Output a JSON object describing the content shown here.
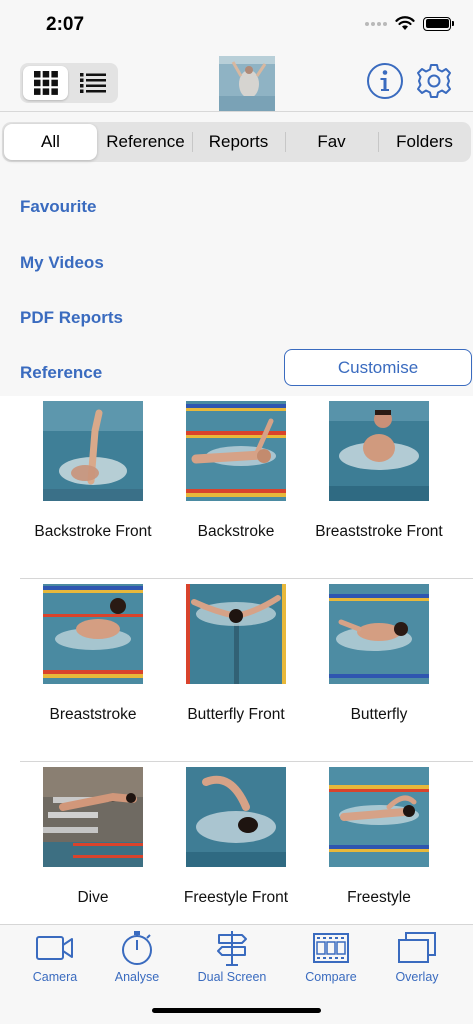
{
  "status_bar": {
    "time": "2:07"
  },
  "toolbar": {
    "view_modes": [
      "grid",
      "list"
    ],
    "selected_view": "grid",
    "info_icon": "info-icon",
    "settings_icon": "gear-icon"
  },
  "tabs": [
    {
      "label": "All",
      "active": true
    },
    {
      "label": "Reference",
      "active": false
    },
    {
      "label": "Reports",
      "active": false
    },
    {
      "label": "Fav",
      "active": false
    },
    {
      "label": "Folders",
      "active": false
    }
  ],
  "quick_links": [
    {
      "label": "Favourite"
    },
    {
      "label": "My Videos"
    },
    {
      "label": "PDF Reports"
    },
    {
      "label": "Reference"
    }
  ],
  "customise_label": "Customise",
  "videos": [
    {
      "label": "Backstroke Front"
    },
    {
      "label": "Backstroke"
    },
    {
      "label": "Breaststroke Front"
    },
    {
      "label": "Breaststroke"
    },
    {
      "label": "Butterfly Front"
    },
    {
      "label": "Butterfly"
    },
    {
      "label": "Dive"
    },
    {
      "label": "Freestyle Front"
    },
    {
      "label": "Freestyle"
    }
  ],
  "bottom_tabs": [
    {
      "label": "Camera",
      "icon": "camera-icon"
    },
    {
      "label": "Analyse",
      "icon": "stopwatch-icon"
    },
    {
      "label": "Dual Screen",
      "icon": "signpost-icon"
    },
    {
      "label": "Compare",
      "icon": "film-strip-icon"
    },
    {
      "label": "Overlay",
      "icon": "overlay-icon"
    }
  ],
  "colors": {
    "accent": "#3a6bbf",
    "background": "#f7f7f7",
    "pool_water": "#4e8ea6",
    "lane_rope_red": "#d9432c",
    "lane_rope_yellow": "#e8b83a",
    "lane_rope_blue": "#2f56b0"
  }
}
